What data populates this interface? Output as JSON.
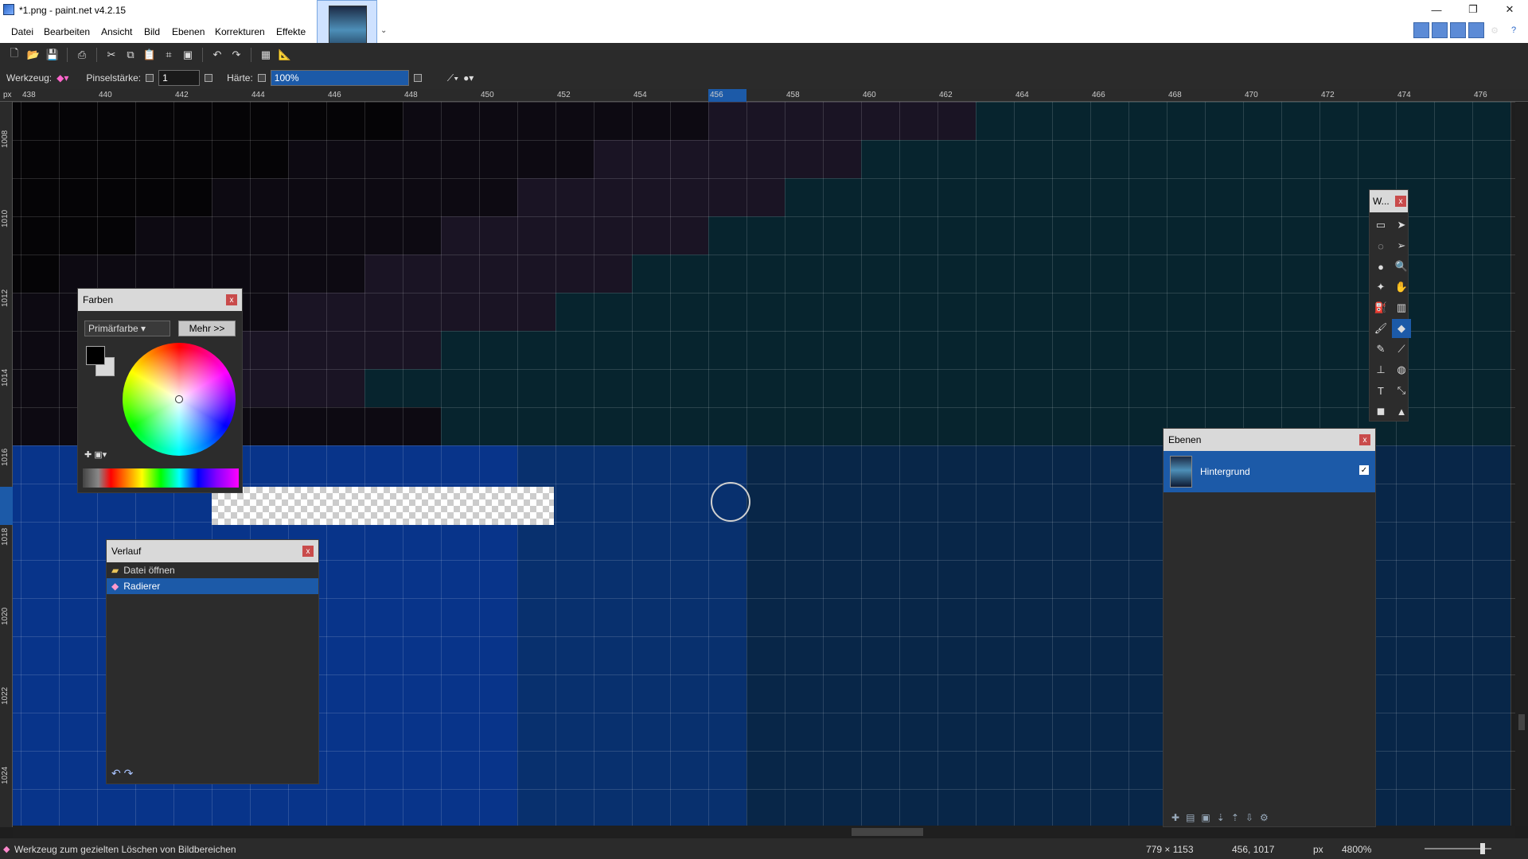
{
  "window": {
    "title": "*1.png - paint.net v4.2.15",
    "buttons": [
      "—",
      "❐",
      "✕"
    ]
  },
  "menu": [
    "Datei",
    "Bearbeiten",
    "Ansicht",
    "Bild",
    "Ebenen",
    "Korrekturen",
    "Effekte"
  ],
  "options": {
    "tool_label": "Werkzeug:",
    "brush_label": "Pinselstärke:",
    "brush_value": "1",
    "hardness_label": "Härte:",
    "hardness_value": "100%"
  },
  "ruler": {
    "unit": "px",
    "horizontal": [
      "438",
      "440",
      "442",
      "444",
      "446",
      "448",
      "450",
      "452",
      "454",
      "456",
      "458",
      "460",
      "462",
      "464",
      "466",
      "468",
      "470",
      "472",
      "474",
      "476"
    ],
    "vertical": [
      "1008",
      "1010",
      "1012",
      "1014",
      "1016",
      "1018",
      "1020",
      "1022",
      "1024"
    ]
  },
  "panels": {
    "farben": {
      "title": "Farben",
      "dropdown": "Primärfarbe",
      "more": "Mehr >>"
    },
    "verlauf": {
      "title": "Verlauf",
      "items": [
        "Datei öffnen",
        "Radierer"
      ]
    },
    "werkzeug": {
      "title": "W..."
    },
    "ebenen": {
      "title": "Ebenen",
      "layer": "Hintergrund"
    }
  },
  "status": {
    "hint": "Werkzeug zum gezielten Löschen von Bildbereichen",
    "image_size": "779 × 1153",
    "cursor_pos": "456, 1017",
    "unit": "px",
    "zoom": "4800%"
  },
  "colors": {
    "accent": "#1c5aa8",
    "primary_color": "#000000",
    "secondary_color": "#d8d8d8"
  }
}
